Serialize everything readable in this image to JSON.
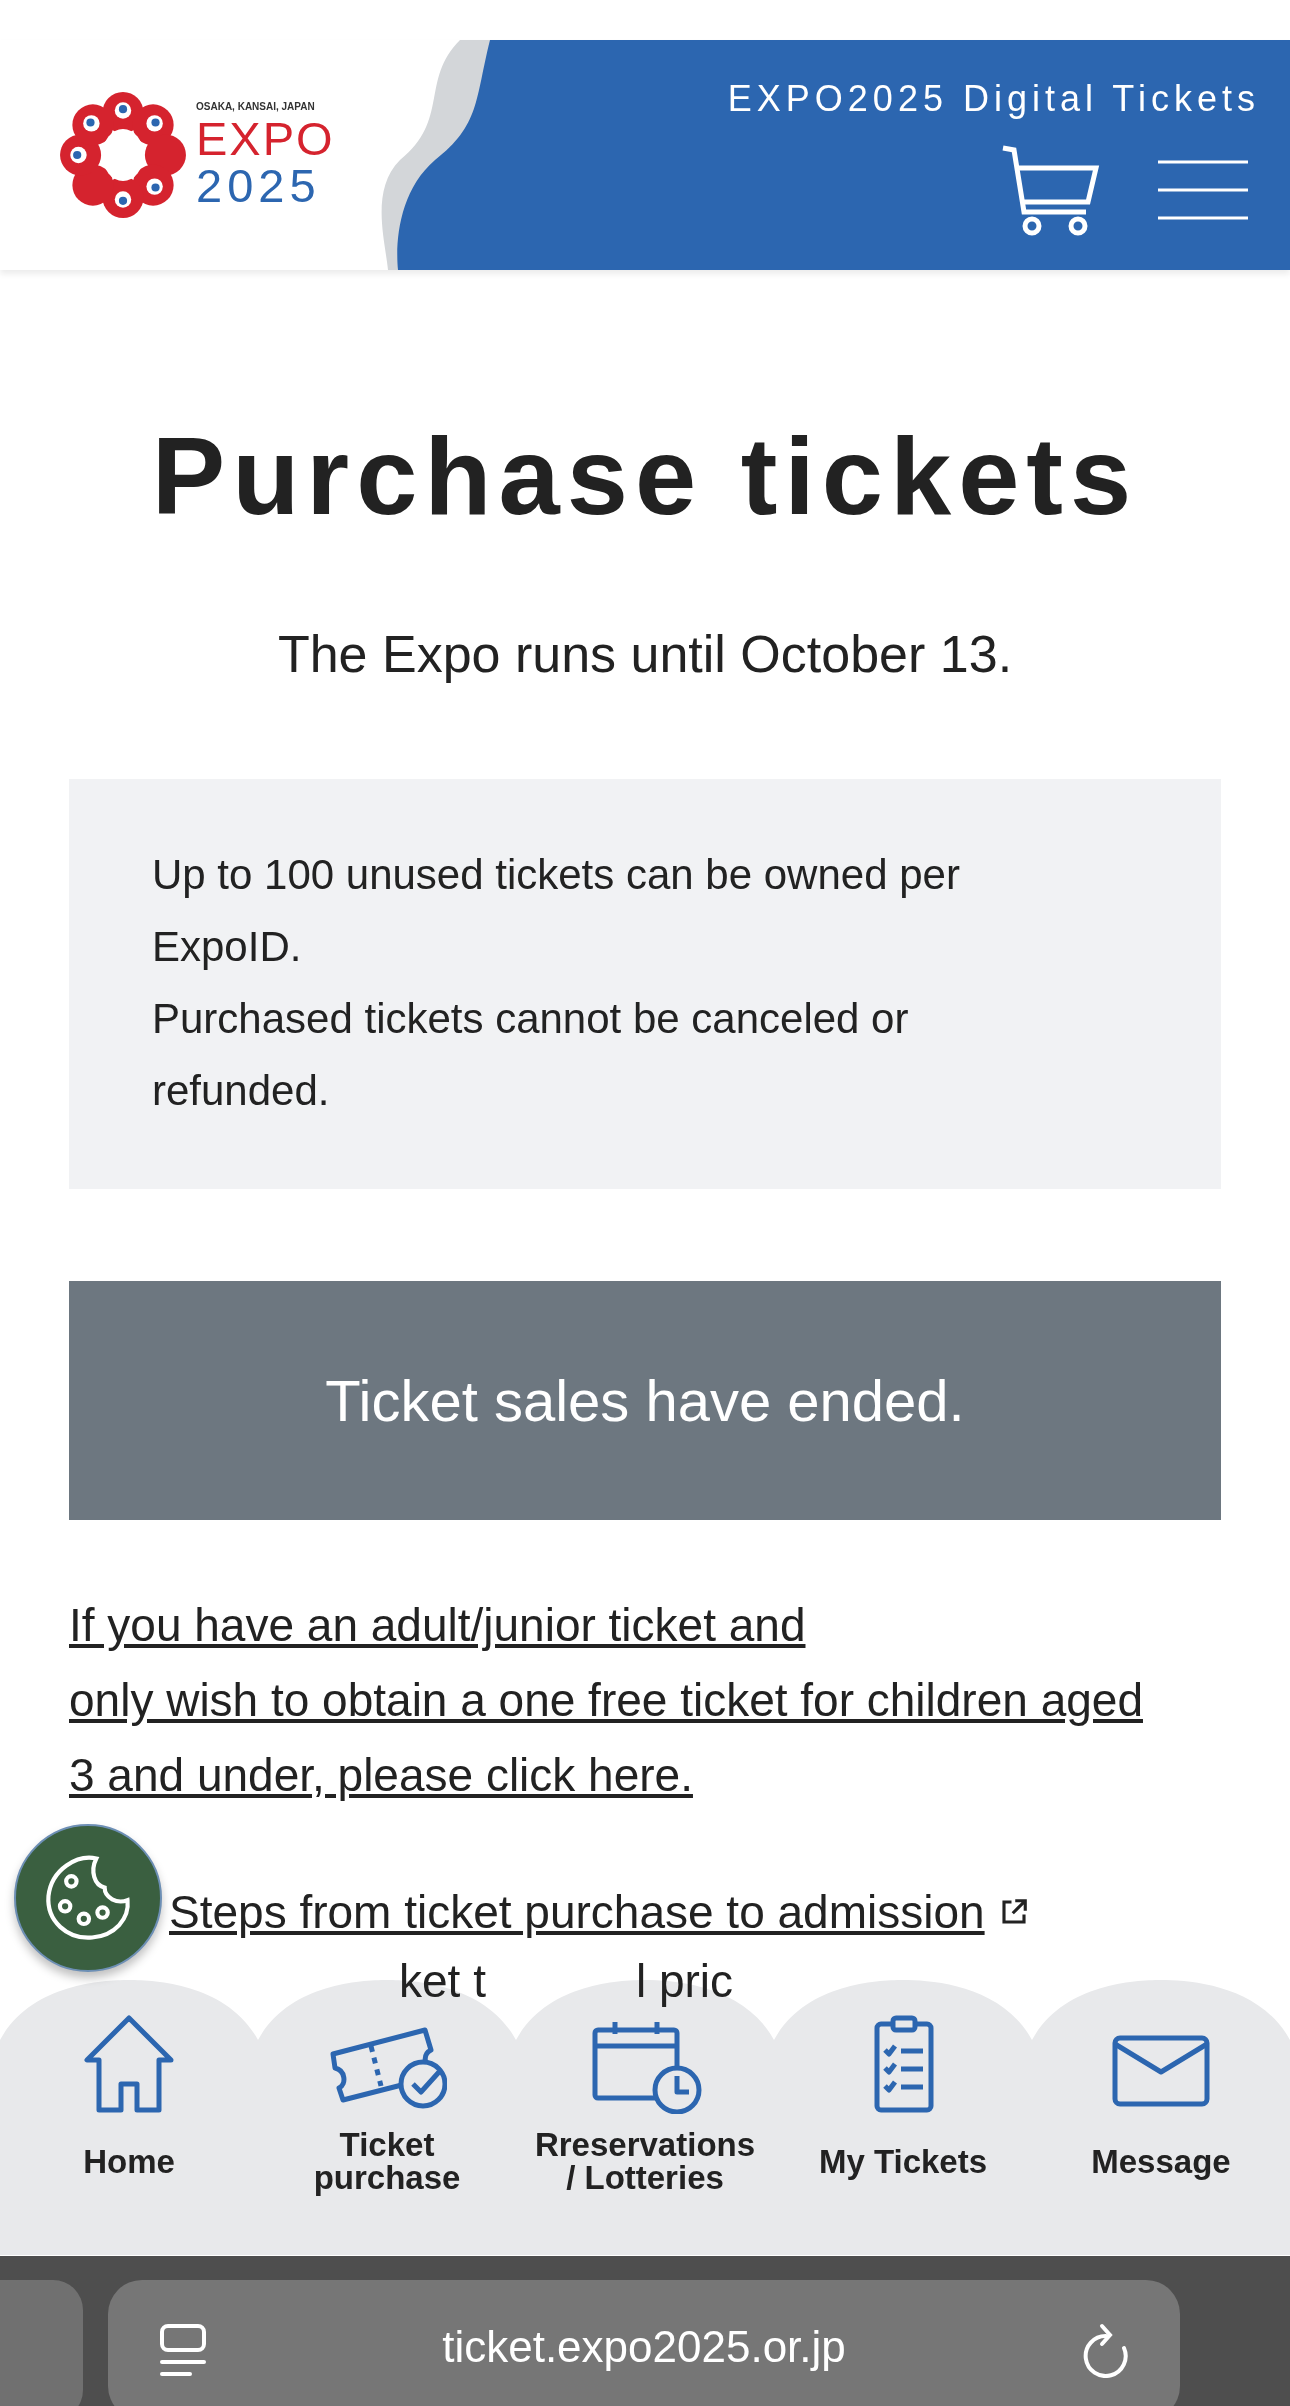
{
  "header": {
    "logo": {
      "tagline": "OSAKA, KANSAI, JAPAN",
      "word": "EXPO",
      "year": "2025"
    },
    "title": "EXPO2025 Digital Tickets"
  },
  "page": {
    "title": "Purchase tickets",
    "subtitle": "The Expo runs until October 13."
  },
  "notice": {
    "lines": [
      "Up to 100 unused tickets can be owned per ExpoID.",
      "Purchased tickets cannot be canceled or refunded."
    ]
  },
  "status_banner": "Ticket sales have ended.",
  "child_link": {
    "lines": [
      "If you have an adult/junior ticket and",
      "only wish to obtain a one free ticket for children aged 3 and under, please click here."
    ]
  },
  "steps_link": {
    "text": "Steps from ticket purchase to admission",
    "external": true
  },
  "partial_link": [
    "ket t",
    "l pric"
  ],
  "nav": [
    {
      "kind": "home",
      "label": "Home"
    },
    {
      "kind": "ticket",
      "label": "Ticket purchase"
    },
    {
      "kind": "calendar",
      "label": "Rreservations / Lotteries"
    },
    {
      "kind": "clipboard",
      "label": "My Tickets"
    },
    {
      "kind": "mail",
      "label": "Message"
    }
  ],
  "browser": {
    "url": "ticket.expo2025.or.jp"
  }
}
